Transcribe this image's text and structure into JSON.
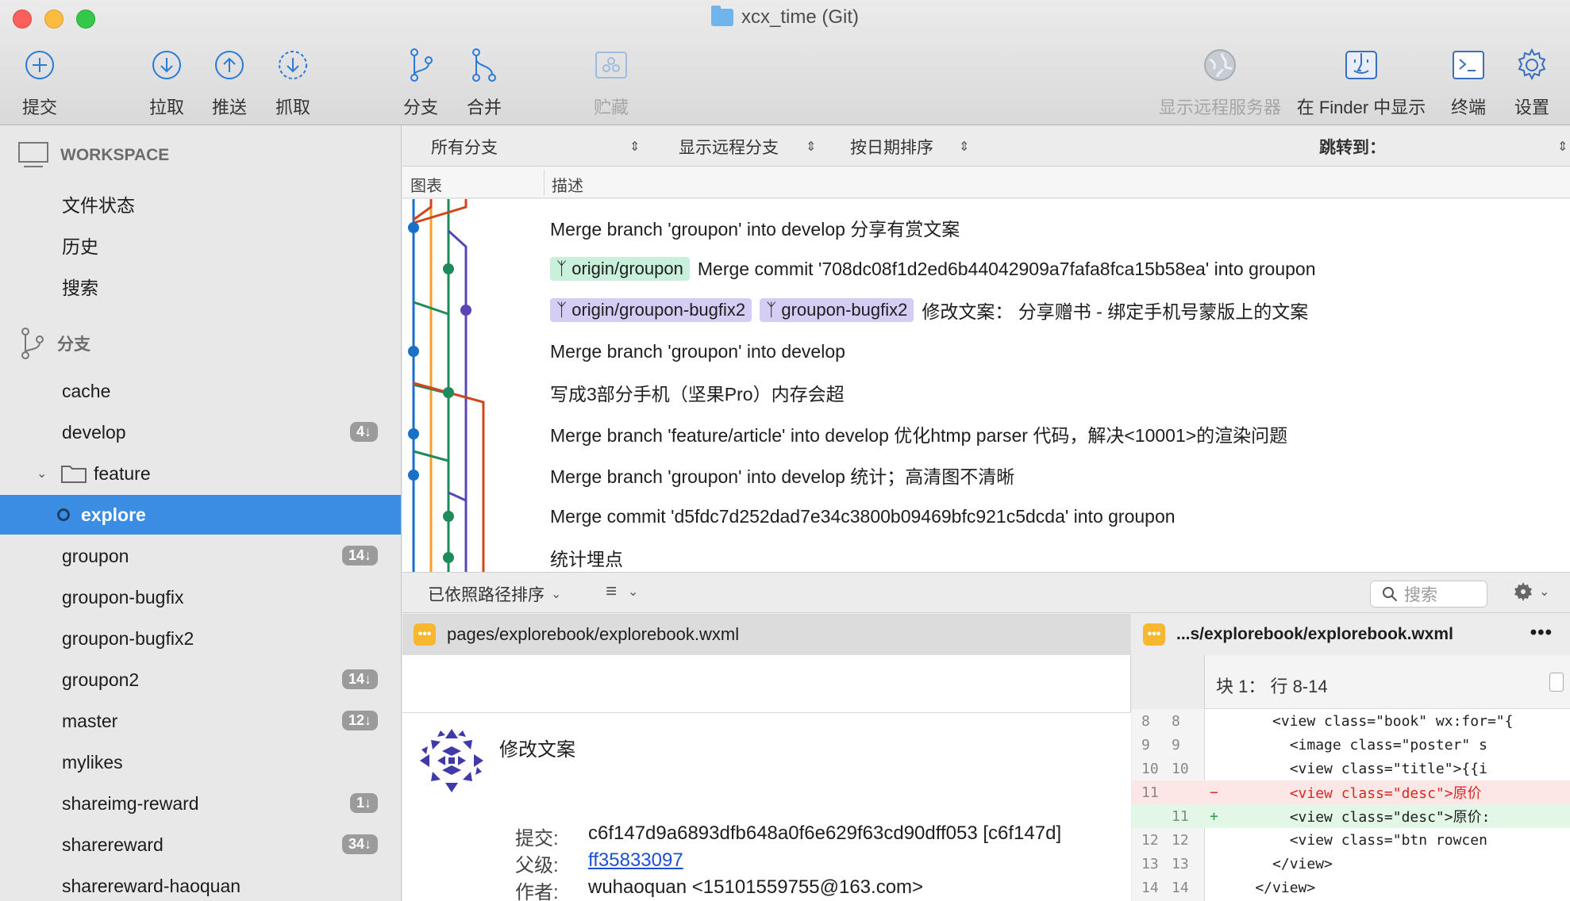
{
  "window": {
    "title": "xcx_time (Git)"
  },
  "toolbar": {
    "commit": "提交",
    "pull": "拉取",
    "push": "推送",
    "fetch": "抓取",
    "branch": "分支",
    "merge": "合并",
    "stash": "贮藏",
    "remote": "显示远程服务器",
    "finder": "在 Finder 中显示",
    "terminal": "终端",
    "settings": "设置"
  },
  "sidebar": {
    "workspace_header": "WORKSPACE",
    "workspace_items": [
      "文件状态",
      "历史",
      "搜索"
    ],
    "branches_header": "分支",
    "branches": [
      {
        "label": "cache",
        "badge": ""
      },
      {
        "label": "develop",
        "badge": "4↓"
      },
      {
        "label": "feature",
        "badge": ""
      },
      {
        "label": "explore",
        "badge": ""
      },
      {
        "label": "groupon",
        "badge": "14↓"
      },
      {
        "label": "groupon-bugfix",
        "badge": ""
      },
      {
        "label": "groupon-bugfix2",
        "badge": ""
      },
      {
        "label": "groupon2",
        "badge": "14↓"
      },
      {
        "label": "master",
        "badge": "12↓"
      },
      {
        "label": "mylikes",
        "badge": ""
      },
      {
        "label": "shareimg-reward",
        "badge": "1↓"
      },
      {
        "label": "sharereward",
        "badge": "34↓"
      },
      {
        "label": "sharereward-haoquan",
        "badge": ""
      }
    ]
  },
  "filters": {
    "all_branches": "所有分支",
    "show_remote": "显示远程分支",
    "sort_date": "按日期排序",
    "jump_to": "跳转到："
  },
  "columns": {
    "graph": "图表",
    "description": "描述"
  },
  "history": [
    {
      "tags": [],
      "message": "Merge branch 'groupon' into develop 分享有赏文案"
    },
    {
      "tags": [
        {
          "text": "origin/groupon",
          "color": "green"
        }
      ],
      "message": "Merge commit '708dc08f1d2ed6b44042909a7fafa8fca15b58ea' into groupon"
    },
    {
      "tags": [
        {
          "text": "origin/groupon-bugfix2",
          "color": "purple"
        },
        {
          "text": "groupon-bugfix2",
          "color": "purple"
        }
      ],
      "message": "修改文案：  分享赠书 - 绑定手机号蒙版上的文案"
    },
    {
      "tags": [],
      "message": "Merge branch 'groupon' into develop"
    },
    {
      "tags": [],
      "message": "写成3部分手机（坚果Pro）内存会超"
    },
    {
      "tags": [],
      "message": "Merge branch 'feature/article' into develop 优化htmp parser 代码，解决<10001>的渲染问题"
    },
    {
      "tags": [],
      "message": "Merge branch 'groupon' into develop 统计；高清图不清晰"
    },
    {
      "tags": [],
      "message": "Merge commit 'd5fdc7d252dad7e34c3800b09469bfc921c5dcda' into groupon"
    },
    {
      "tags": [],
      "message": "统计埋点"
    }
  ],
  "lower": {
    "sort_by_path": "已依照路径排序",
    "search_placeholder": "搜索"
  },
  "file": {
    "path": "pages/explorebook/explorebook.wxml"
  },
  "commit": {
    "title": "修改文案",
    "commit_label": "提交:",
    "commit_value": "c6f147d9a6893dfb648a0f6e629f63cd90dff053 [c6f147d]",
    "parent_label": "父级:",
    "parent_value": "ff35833097",
    "author_label": "作者:",
    "author_value": "wuhaoquan <15101559755@163.com>"
  },
  "diff": {
    "path": "...s/explorebook/explorebook.wxml",
    "hunk": "块 1：  行 8-14",
    "lines": [
      {
        "old": "8",
        "new": "8",
        "mark": "",
        "type": "ctx",
        "text": "      <view class=\"book\" wx:for=\"{"
      },
      {
        "old": "9",
        "new": "9",
        "mark": "",
        "type": "ctx",
        "text": "        <image class=\"poster\" s"
      },
      {
        "old": "10",
        "new": "10",
        "mark": "",
        "type": "ctx",
        "text": "        <view class=\"title\">{{i"
      },
      {
        "old": "11",
        "new": "",
        "mark": "−",
        "type": "del",
        "text": "        <view class=\"desc\">原价"
      },
      {
        "old": "",
        "new": "11",
        "mark": "+",
        "type": "add",
        "text": "        <view class=\"desc\">原价:"
      },
      {
        "old": "12",
        "new": "12",
        "mark": "",
        "type": "ctx",
        "text": "        <view class=\"btn rowcen"
      },
      {
        "old": "13",
        "new": "13",
        "mark": "",
        "type": "ctx",
        "text": "      </view>"
      },
      {
        "old": "14",
        "new": "14",
        "mark": "",
        "type": "ctx",
        "text": "    </view>"
      }
    ]
  },
  "colors": {
    "accent": "#3b8de3",
    "graph_blue": "#1a6fc9",
    "graph_orange": "#f0a030",
    "graph_green": "#1f8a5a",
    "graph_purple": "#5a44b8",
    "graph_red": "#d0451b"
  }
}
